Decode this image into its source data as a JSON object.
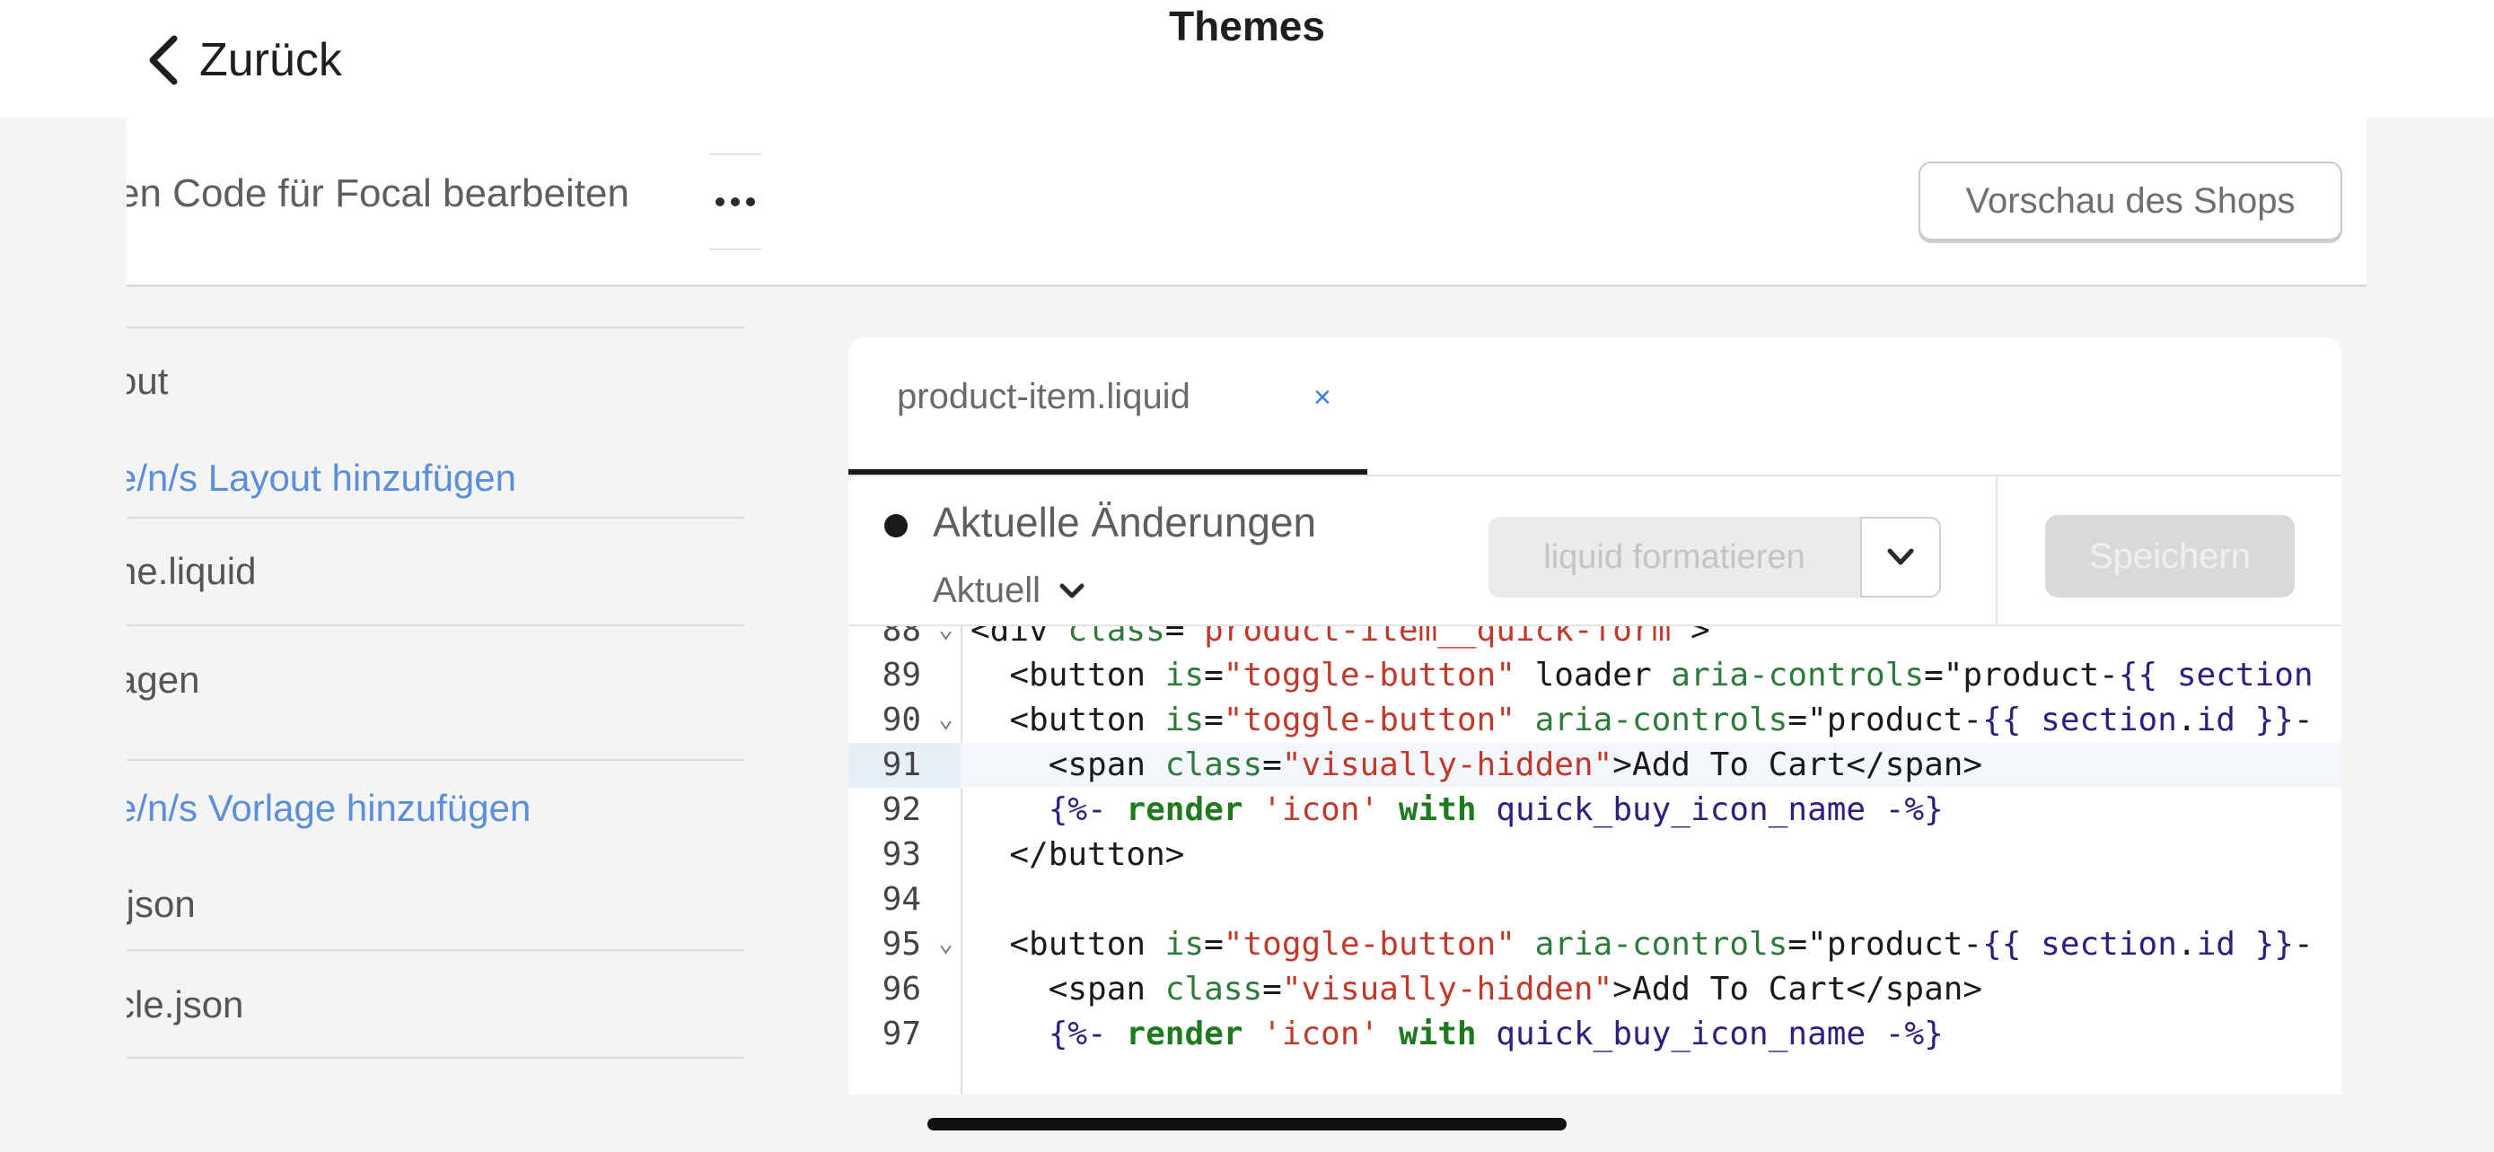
{
  "nav": {
    "back_label": "Zurück",
    "title": "Themes"
  },
  "editor_header": {
    "title": "en Code für Focal bearbeiten",
    "more_icon": "more-horizontal-icon",
    "preview_label": "Vorschau des Shops"
  },
  "sidebar": {
    "items": [
      {
        "label": "out",
        "kind": "file"
      },
      {
        "label": "e/n/s Layout hinzufügen",
        "kind": "link"
      },
      {
        "label": "ne.liquid",
        "kind": "file"
      },
      {
        "label": "agen",
        "kind": "file"
      },
      {
        "label": "e/n/s Vorlage hinzufügen",
        "kind": "link"
      },
      {
        "label": ".json",
        "kind": "file"
      },
      {
        "label": "cle.json",
        "kind": "file"
      }
    ]
  },
  "editor": {
    "tab": {
      "name": "product-item.liquid",
      "close": "×"
    },
    "status": {
      "label": "Aktuelle Änderungen",
      "version": "Aktuell"
    },
    "format_button": "liquid formatieren",
    "save_button": "Speichern",
    "active_line": 91,
    "lines": [
      {
        "n": "88",
        "fold": true,
        "text": "<div class=\"product-item__quick-form\">"
      },
      {
        "n": "89",
        "fold": false,
        "text": "  <button is=\"toggle-button\" loader aria-controls=\"product-{{ section"
      },
      {
        "n": "90",
        "fold": true,
        "text": "  <button is=\"toggle-button\" aria-controls=\"product-{{ section.id }}-"
      },
      {
        "n": "91",
        "fold": false,
        "text": "    <span class=\"visually-hidden\">Add To Cart</span>"
      },
      {
        "n": "92",
        "fold": false,
        "text": "    {%- render 'icon' with quick_buy_icon_name -%}"
      },
      {
        "n": "93",
        "fold": false,
        "text": "  </button>"
      },
      {
        "n": "94",
        "fold": false,
        "text": ""
      },
      {
        "n": "95",
        "fold": true,
        "text": "  <button is=\"toggle-button\" aria-controls=\"product-{{ section.id }}-"
      },
      {
        "n": "96",
        "fold": false,
        "text": "    <span class=\"visually-hidden\">Add To Cart</span>"
      },
      {
        "n": "97",
        "fold": false,
        "text": "    {%- render 'icon' with quick_buy_icon_name -%}"
      }
    ]
  },
  "colors": {
    "link": "#5b8fdb",
    "tag": "#1a1a1a",
    "attribute": "#2d7a3a",
    "string": "#c0392b",
    "variable": "#2a2080",
    "keyword": "#1f7a1f"
  }
}
